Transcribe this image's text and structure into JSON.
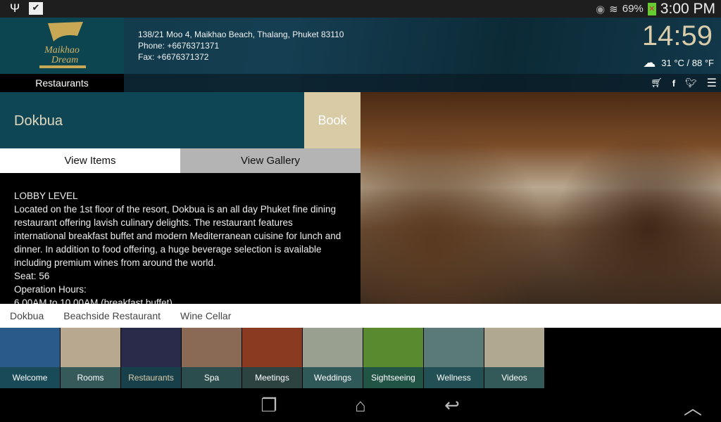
{
  "status": {
    "battery": "69%",
    "time": "3:00 PM",
    "icons": [
      "usb-icon",
      "bag-check-icon",
      "eye-icon",
      "wifi-icon",
      "battery-icon"
    ]
  },
  "header": {
    "logo_text": "Maikhao Dream",
    "address": "138/21 Moo 4, Maikhao Beach, Thalang, Phuket 83110",
    "phone": "Phone: +6676371371",
    "fax": "Fax: +6676371372",
    "clock": "14:59",
    "weather": "31 °C / 88 °F",
    "section": "Restaurants"
  },
  "restaurant": {
    "name": "Dokbua",
    "book": "Book",
    "tabs": [
      "View Items",
      "View Gallery"
    ],
    "desc": [
      "LOBBY LEVEL",
      "Located on the 1st floor of the resort, Dokbua is an all day Phuket fine dining restaurant offering lavish culinary delights. The restaurant features international breakfast buffet and modern Mediterranean cuisine for lunch and dinner. In addition to food offering, a huge beverage selection is available including premium wines from around the world.",
      "Seat: 56",
      "Operation Hours:",
      "6.00AM to 10.00AM (breakfast buffet)"
    ]
  },
  "submenu": [
    "Dokbua",
    "Beachside Restaurant",
    "Wine Cellar"
  ],
  "tiles": [
    {
      "label": "Welcome",
      "bg": "#2a5a8a"
    },
    {
      "label": "Rooms",
      "bg": "#b8a890"
    },
    {
      "label": "Restaurants",
      "bg": "#2a2a4a"
    },
    {
      "label": "Spa",
      "bg": "#8a6a55"
    },
    {
      "label": "Meetings",
      "bg": "#8a3a20"
    },
    {
      "label": "Weddings",
      "bg": "#9aa090"
    },
    {
      "label": "Sightseeing",
      "bg": "#5a8a30"
    },
    {
      "label": "Wellness",
      "bg": "#5a7a78"
    },
    {
      "label": "Videos",
      "bg": "#b0a890"
    }
  ],
  "colors": {
    "accent": "#d8cba6",
    "teal": "#0e4655",
    "active_tile_label": "#d9ccaa"
  }
}
